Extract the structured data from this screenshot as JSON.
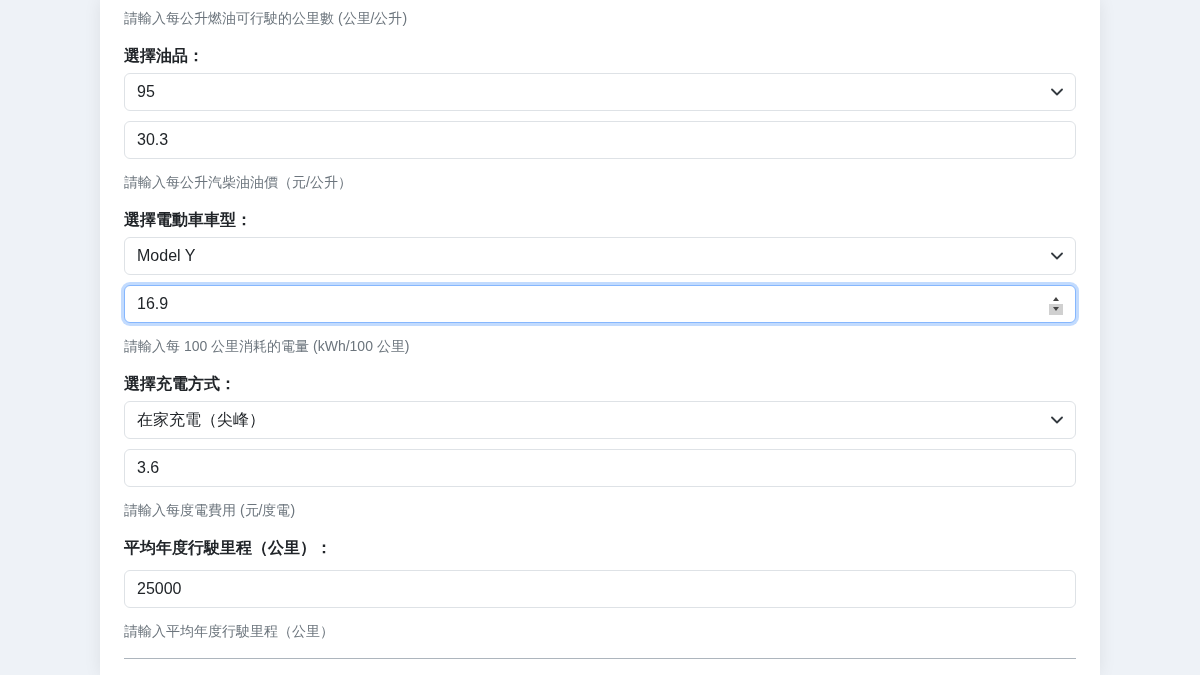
{
  "form": {
    "items": [
      {
        "kind": "hint",
        "text": "請輸入每公升燃油可行駛的公里數 (公里/公升)"
      },
      {
        "kind": "label",
        "text": "選擇油品："
      },
      {
        "kind": "select",
        "value": "95"
      },
      {
        "kind": "input",
        "value": "30.3",
        "focused": false
      },
      {
        "kind": "hint",
        "text": "請輸入每公升汽柴油油價（元/公升）"
      },
      {
        "kind": "label",
        "text": "選擇電動車車型："
      },
      {
        "kind": "select",
        "value": "Model Y"
      },
      {
        "kind": "input",
        "value": "16.9",
        "focused": true
      },
      {
        "kind": "hint",
        "text": "請輸入每 100 公里消耗的電量 (kWh/100 公里)"
      },
      {
        "kind": "label",
        "text": "選擇充電方式："
      },
      {
        "kind": "select",
        "value": "在家充電（尖峰）"
      },
      {
        "kind": "input",
        "value": "3.6",
        "focused": false
      },
      {
        "kind": "hint",
        "text": "請輸入每度電費用 (元/度電)"
      },
      {
        "kind": "label",
        "text": "平均年度行駛里程（公里）："
      },
      {
        "kind": "input",
        "value": "25000",
        "focused": false
      },
      {
        "kind": "hint",
        "text": "請輸入平均年度行駛里程（公里）"
      }
    ]
  }
}
